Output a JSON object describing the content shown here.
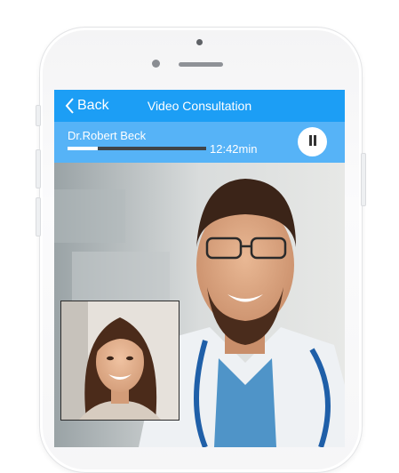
{
  "header": {
    "back_label": "Back",
    "title": "Video Consultation"
  },
  "call": {
    "caller_name": "Dr.Robert Beck",
    "duration": "12:42min",
    "progress": 0.22
  },
  "colors": {
    "header_bg": "#1c9ef5",
    "callbar_bg": "#56b3f7"
  },
  "icons": {
    "back": "chevron-left-icon",
    "pause": "pause-icon"
  }
}
